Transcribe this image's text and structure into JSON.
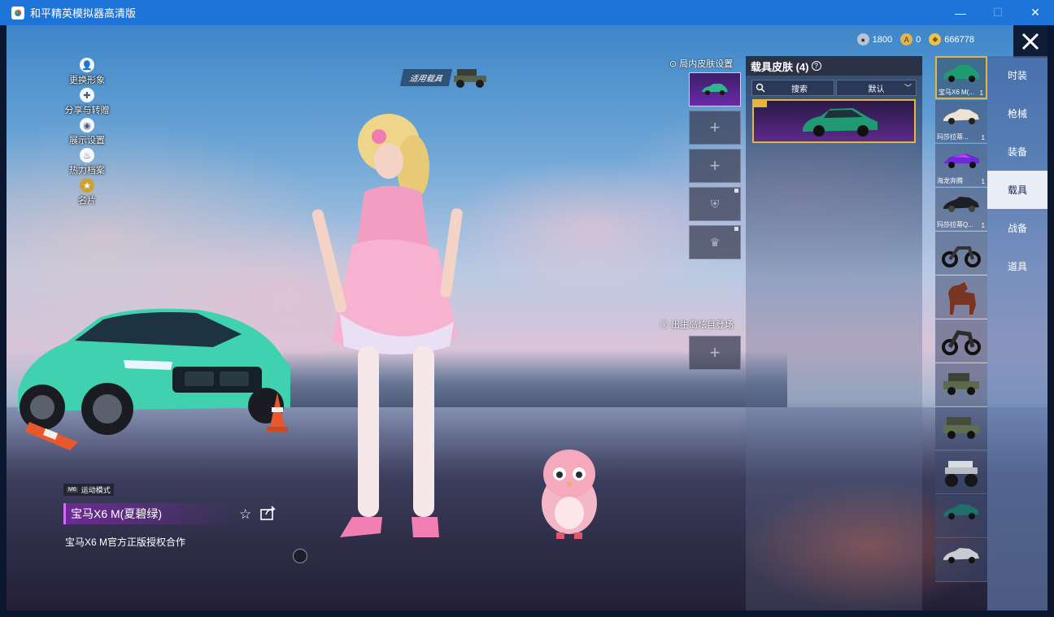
{
  "window": {
    "title": "和平精英模拟器高清版",
    "controls": [
      "—",
      "☐",
      "✕"
    ]
  },
  "currency": [
    {
      "icon": "silver-coin-icon",
      "value": "1800",
      "color": "#b8c4d6"
    },
    {
      "icon": "gold-coupon-icon",
      "value": "0",
      "color": "#e2b54a"
    },
    {
      "icon": "gold-coin-icon",
      "value": "666778",
      "color": "#f0c14b"
    }
  ],
  "left_menu": [
    {
      "label": "更换形象",
      "icon": "person-icon"
    },
    {
      "label": "分享与转赠",
      "icon": "share-gift-icon"
    },
    {
      "label": "展示设置",
      "icon": "eye-icon"
    },
    {
      "label": "热力档案",
      "icon": "flame-icon"
    },
    {
      "label": "名片",
      "icon": "badge-icon"
    }
  ],
  "applied_vehicle_label": "适用载具",
  "in_match_skin": {
    "title": "局内皮肤设置",
    "slots": [
      {
        "state": "selected",
        "icon": "green-car-icon"
      },
      {
        "state": "empty",
        "icon": "plus-icon"
      },
      {
        "state": "empty",
        "icon": "plus-icon"
      },
      {
        "state": "locked",
        "icon": "badge-slot-icon"
      },
      {
        "state": "locked",
        "icon": "crown-slot-icon"
      }
    ]
  },
  "spawn_island": {
    "title": "出生岛炫目登场",
    "slot_icon": "plus-icon"
  },
  "skin_panel": {
    "title": "载具皮肤 (4)",
    "search_label": "搜索",
    "sort_label": "默认",
    "selected_card": {
      "name": "宝马X6 M(夏碧绿)",
      "color": "#1b7a5c"
    }
  },
  "vehicle_list": [
    {
      "name": "宝马X6 M(...",
      "count": "1",
      "icon": "green-suv-icon",
      "active": true
    },
    {
      "name": "玛莎拉蒂...",
      "count": "1",
      "icon": "white-coupe-icon",
      "active": false
    },
    {
      "name": "海龙奔腾",
      "count": "1",
      "icon": "purple-racer-icon",
      "active": false
    },
    {
      "name": "玛莎拉蒂Q...",
      "count": "1",
      "icon": "black-sedan-icon",
      "active": false
    },
    {
      "name": "",
      "count": "",
      "icon": "motorcycle-icon",
      "active": false
    },
    {
      "name": "",
      "count": "",
      "icon": "horse-icon",
      "active": false
    },
    {
      "name": "",
      "count": "",
      "icon": "motorcycle-sidecar-icon",
      "active": false
    },
    {
      "name": "",
      "count": "",
      "icon": "jeep-icon",
      "active": false
    },
    {
      "name": "",
      "count": "",
      "icon": "army-jeep-icon",
      "active": false
    },
    {
      "name": "",
      "count": "",
      "icon": "monster-truck-icon",
      "active": false
    },
    {
      "name": "",
      "count": "",
      "icon": "teal-sedan-icon",
      "active": false
    },
    {
      "name": "",
      "count": "",
      "icon": "silver-sedan-icon",
      "active": false
    }
  ],
  "categories": [
    {
      "label": "时装",
      "active": false
    },
    {
      "label": "枪械",
      "active": false
    },
    {
      "label": "装备",
      "active": false
    },
    {
      "label": "载具",
      "active": true
    },
    {
      "label": "战备",
      "active": false
    },
    {
      "label": "道具",
      "active": false
    }
  ],
  "bottom_info": {
    "mode_badge": "运动模式",
    "mode_prefix": "M6",
    "skin_name": "宝马X6 M(夏碧绿)",
    "description": "宝马X6 M官方正版授权合作"
  }
}
